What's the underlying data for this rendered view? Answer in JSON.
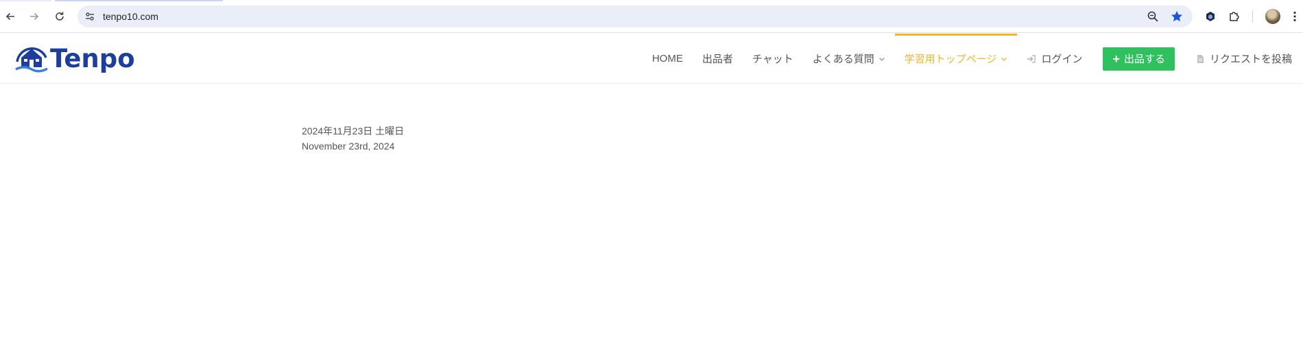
{
  "browser": {
    "url": "tenpo10.com",
    "icons": {
      "back": "arrow-left-icon",
      "forward": "arrow-right-icon",
      "reload": "reload-icon",
      "site_info": "tune-icon",
      "zoom": "zoom-icon",
      "bookmark": "star-icon",
      "extension": "extension-cube-icon",
      "extensions_menu": "puzzle-icon",
      "profile": "avatar",
      "menu": "kebab-menu-icon"
    },
    "accent_color": "#1a56db"
  },
  "site": {
    "logo_text": "Tenpo",
    "brand_color": "#1d3f9c",
    "nav": {
      "home": "HOME",
      "sellers": "出品者",
      "chat": "チャット",
      "faq": "よくある質問",
      "learning": "学習用トップページ",
      "login": "ログイン",
      "post": "出品する",
      "request": "リクエストを投稿"
    },
    "active_color": "#f6b529",
    "post_button_color": "#2ec15d"
  },
  "content": {
    "date_jp": "2024年11月23日 土曜日",
    "date_en": "November 23rd, 2024"
  }
}
